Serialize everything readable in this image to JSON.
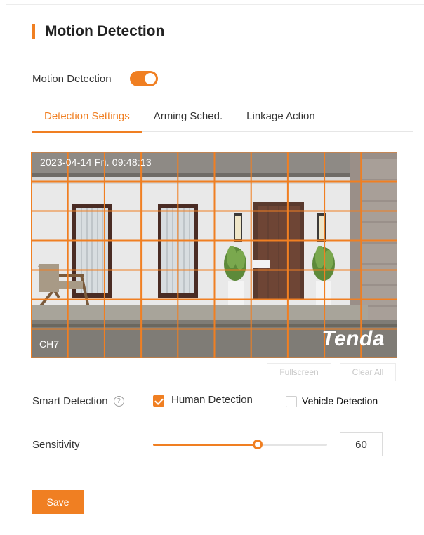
{
  "page": {
    "title": "Motion Detection",
    "accent_color": "#f07f22"
  },
  "motion_detection": {
    "label": "Motion Detection",
    "enabled": true
  },
  "tabs": [
    {
      "label": "Detection Settings",
      "active": true
    },
    {
      "label": "Arming Sched.",
      "active": false
    },
    {
      "label": "Linkage Action",
      "active": false
    }
  ],
  "video": {
    "timestamp": "2023-04-14  Fri.   09:48:13",
    "channel": "CH7",
    "brand": "Tenda",
    "grid": {
      "columns": 10,
      "rows": 7,
      "all_selected": true
    }
  },
  "video_actions": {
    "fullscreen_label": "Fullscreen",
    "clear_all_label": "Clear All"
  },
  "smart_detection": {
    "label": "Smart Detection",
    "help_icon": "question-circle-icon",
    "human": {
      "label": "Human Detection",
      "checked": true
    },
    "vehicle": {
      "label": "Vehicle Detection",
      "checked": false
    }
  },
  "sensitivity": {
    "label": "Sensitivity",
    "value": "60",
    "slider_fraction": 0.6
  },
  "save_label": "Save"
}
